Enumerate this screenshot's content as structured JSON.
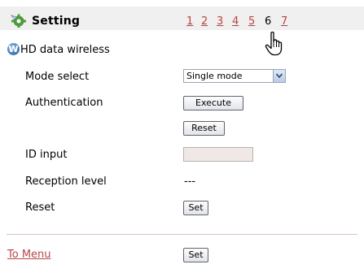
{
  "header": {
    "title": "Setting",
    "icon": "gear-icon",
    "pages": [
      {
        "label": "1",
        "current": false
      },
      {
        "label": "2",
        "current": false
      },
      {
        "label": "3",
        "current": false
      },
      {
        "label": "4",
        "current": false
      },
      {
        "label": "5",
        "current": false
      },
      {
        "label": "6",
        "current": true
      },
      {
        "label": "7",
        "current": false
      }
    ]
  },
  "section": {
    "icon_letter": "W",
    "icon": "w-circle-icon",
    "title": "HD data wireless"
  },
  "rows": {
    "mode_select": {
      "label": "Mode select",
      "value": "Single mode",
      "options": [
        "Single mode"
      ]
    },
    "authentication": {
      "label": "Authentication",
      "execute_label": "Execute",
      "reset_label": "Reset"
    },
    "id_input": {
      "label": "ID input",
      "value": "",
      "placeholder": ""
    },
    "reception": {
      "label": "Reception level",
      "value": "---"
    },
    "reset": {
      "label": "Reset",
      "set_label": "Set"
    }
  },
  "footer": {
    "menu_link": "To Menu",
    "set_label": "Set"
  },
  "colors": {
    "link": "#b64545",
    "header_bg": "#f0f0f0",
    "input_bg": "#efe8e4",
    "divider": "#d8c4bd"
  },
  "cursor": "hand-pointer-icon"
}
